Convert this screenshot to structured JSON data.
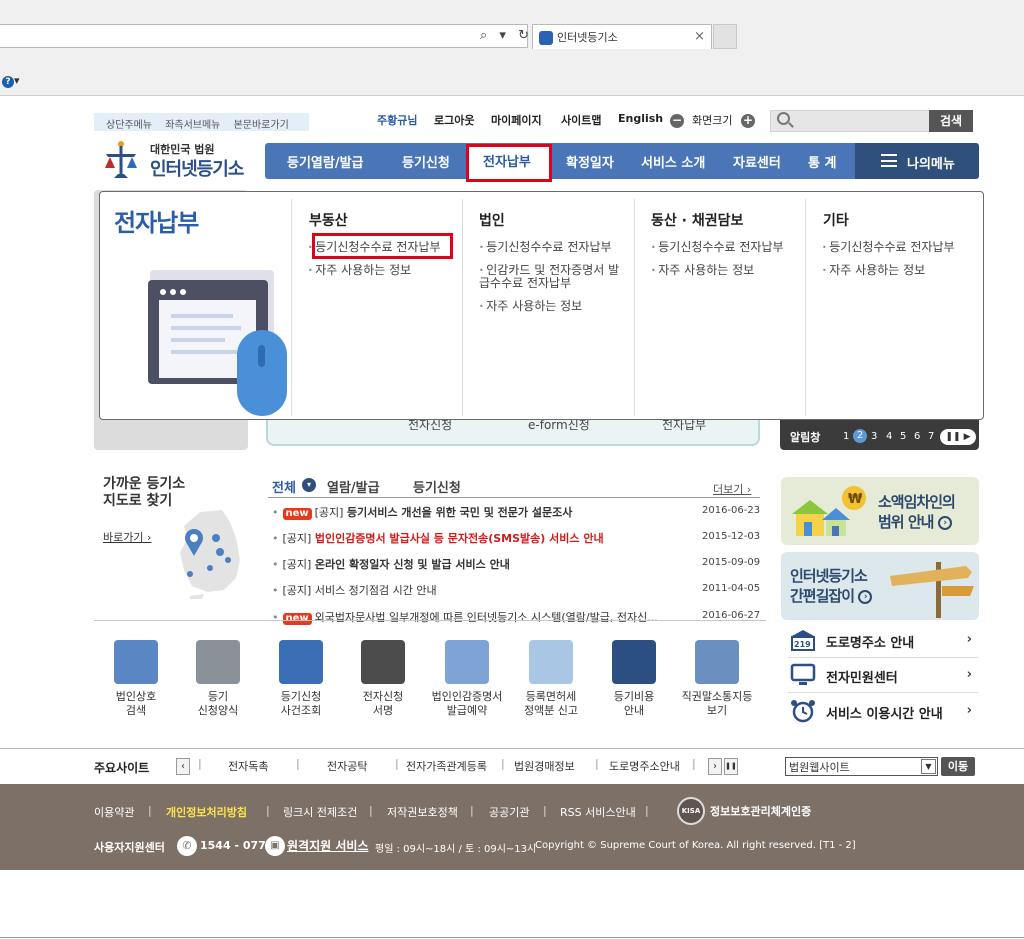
{
  "browser": {
    "tab_title": "인터넷등기소",
    "tab_close": "×",
    "address_icons": "⌕ ▾ ↻",
    "help": "▾"
  },
  "skip_links": [
    "상단주메뉴",
    "좌측서브메뉴",
    "본문바로가기"
  ],
  "util_nav": {
    "items": [
      "주황규님",
      "로그아웃",
      "마이페이지",
      "사이트맵",
      "English",
      "화면크기"
    ],
    "zoom_minus": "−",
    "zoom_plus": "+",
    "search_placeholder": "",
    "search_button": "검색"
  },
  "logo": {
    "sub": "대한민국 법원",
    "main": "인터넷등기소"
  },
  "gnb": {
    "items": [
      "등기열람/발급",
      "등기신청",
      "전자납부",
      "확정일자",
      "서비스 소개",
      "자료센터",
      "통 계"
    ],
    "my_menu": "나의메뉴"
  },
  "background_tabs": [
    "전자신청",
    "e-form신청",
    "전자납부"
  ],
  "alert": {
    "label": "알림창",
    "pages": [
      "1",
      "2",
      "3",
      "4",
      "5",
      "6",
      "7"
    ],
    "current": "2",
    "control": "❚❚ ▶"
  },
  "dropdown": {
    "title": "전자납부",
    "columns": [
      {
        "head": "부동산",
        "links": [
          "등기신청수수료 전자납부",
          "자주 사용하는 정보"
        ]
      },
      {
        "head": "법인",
        "links": [
          "등기신청수수료 전자납부",
          "인감카드 및 전자증명서 발급수수료 전자납부",
          "자주 사용하는 정보"
        ]
      },
      {
        "head": "동산 · 채권담보",
        "links": [
          "등기신청수수료 전자납부",
          "자주 사용하는 정보"
        ]
      },
      {
        "head": "기타",
        "links": [
          "등기신청수수료 전자납부",
          "자주 사용하는 정보"
        ]
      }
    ]
  },
  "nearby": {
    "title_line1": "가까운 등기소",
    "title_line2": "지도로 찾기",
    "link": "바로가기 ›"
  },
  "notices": {
    "tabs": [
      "전체",
      "열람/발급",
      "등기신청"
    ],
    "tab_dot": "▾",
    "more": "더보기 ›",
    "new_badge": "new",
    "rows": [
      {
        "new": true,
        "prefix": "[공지]",
        "text": "등기서비스 개선을 위한 국민 및 전문가 설문조사",
        "date": "2016-06-23",
        "style": "bold"
      },
      {
        "new": false,
        "prefix": "[공지]",
        "text": "법인인감증명서 발급사실 등 문자전송(SMS발송) 서비스 안내",
        "date": "2015-12-03",
        "style": "red"
      },
      {
        "new": false,
        "prefix": "[공지]",
        "text": "온라인 확정일자 신청 및 발급 서비스 안내",
        "date": "2015-09-09",
        "style": "bold"
      },
      {
        "new": false,
        "prefix": "[공지]",
        "text": "서비스 정기점검 시간 안내",
        "date": "2011-04-05",
        "style": "normal"
      },
      {
        "new": true,
        "prefix": "",
        "text": "외국법자문사법 일부개정에 따른 인터넷등기소 시스템(열람/발급, 전자신...",
        "date": "2016-06-27",
        "style": "normal"
      }
    ]
  },
  "banners": {
    "b1_line1": "소액임차인의",
    "b1_line2": "범위 안내",
    "b2_line1": "인터넷등기소",
    "b2_line2": "간편길잡이",
    "arrow": "›",
    "services": [
      "도로명주소 안내",
      "전자민원센터",
      "서비스 이용시간 안내"
    ],
    "service_chevron": "›",
    "road_icon_text": "219"
  },
  "quick_icons": [
    {
      "line1": "법인상호",
      "line2": "검색",
      "color": "#5a86c4"
    },
    {
      "line1": "등기",
      "line2": "신청양식",
      "color": "#8b9199"
    },
    {
      "line1": "등기신청",
      "line2": "사건조회",
      "color": "#3a6fb5"
    },
    {
      "line1": "전자신청",
      "line2": "서명",
      "color": "#4c4c4c"
    },
    {
      "line1": "법인인감증명서",
      "line2": "발급예약",
      "color": "#7ea3d6"
    },
    {
      "line1": "등록면허세",
      "line2": "정액분 신고",
      "color": "#a9c6e5"
    },
    {
      "line1": "등기비용",
      "line2": "안내",
      "color": "#2b4f82"
    },
    {
      "line1": "직권말소통지등",
      "line2": "보기",
      "color": "#6b8fbf"
    }
  ],
  "main_sites": {
    "label": "주요사이트",
    "prev": "‹",
    "next": "›",
    "pause": "❚❚",
    "items": [
      "전자독촉",
      "전자공탁",
      "전자가족관계등록",
      "법원경매정보",
      "도로명주소안내"
    ],
    "select_value": "법원웹사이트",
    "select_arrow": "▼",
    "go": "이동"
  },
  "footer": {
    "links": [
      "이용약관",
      "개인정보처리방침",
      "링크시 전제조건",
      "저작권보호정책",
      "공공기관",
      "RSS 서비스안내"
    ],
    "kisa_badge": "KISA",
    "kisa_text": "정보보호관리체계인증",
    "center_label": "사용자지원센터",
    "phone_icon": "✆",
    "phone": "1544 - 0770",
    "remote_icon": "▣",
    "remote": "원격지원 서비스",
    "hours": "평일 : 09시~18시 / 토 : 09시~13시",
    "copyright": "Copyright © Supreme Court of Korea. All right reserved. [T1 - 2]"
  },
  "colors": {
    "gnb_blue": "#4a76b7",
    "highlight_red": "#e0001b",
    "title_blue": "#2a5fa7",
    "footer_brown": "#7d7066"
  }
}
